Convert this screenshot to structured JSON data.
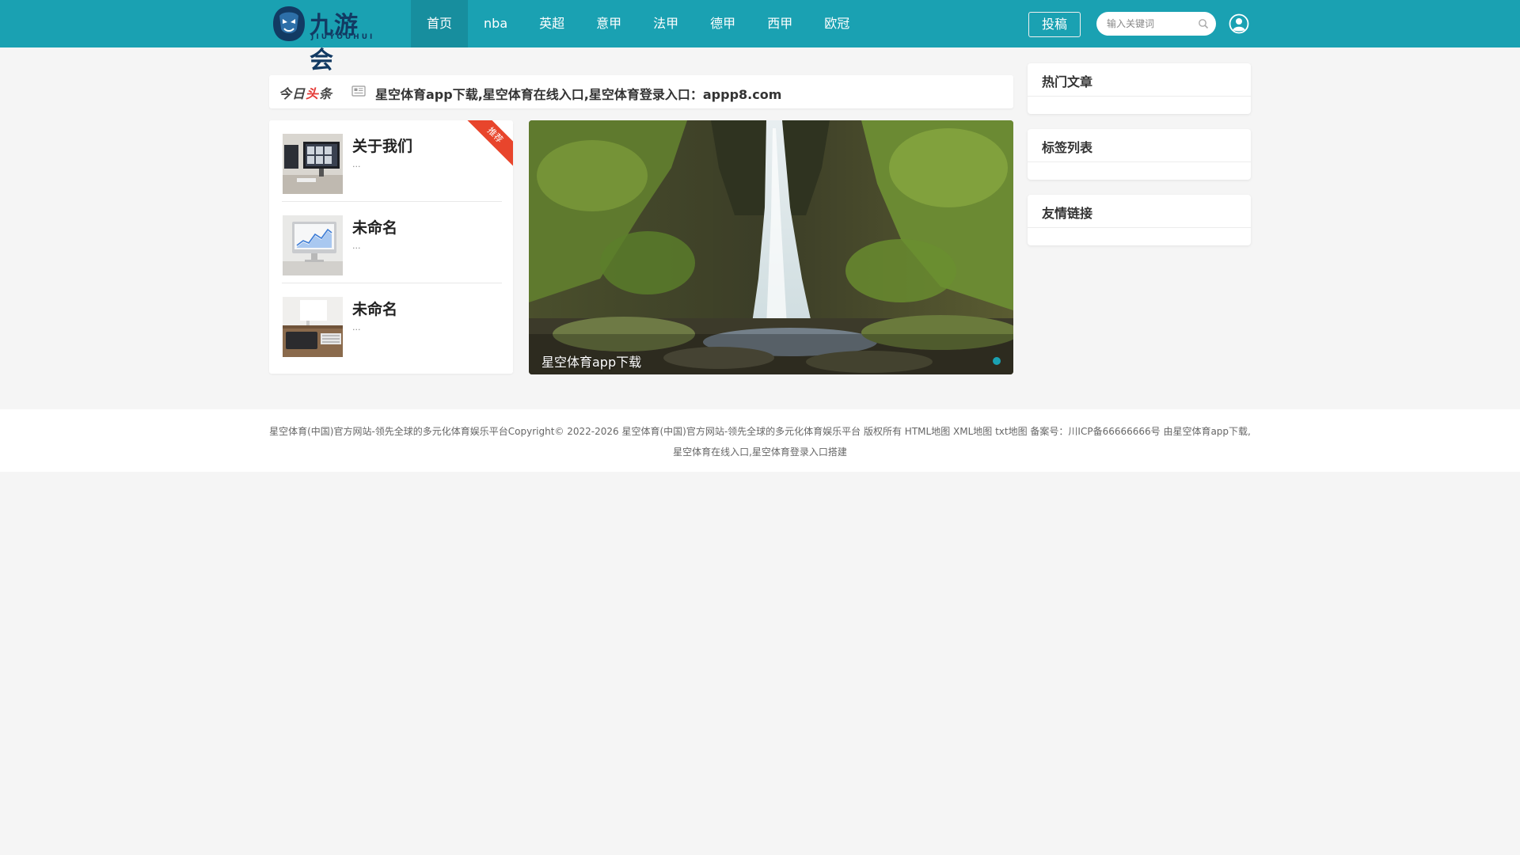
{
  "header": {
    "logo_text": "九游会",
    "logo_sub": "JIUYOUHUI",
    "nav": [
      {
        "label": "首页",
        "active": true
      },
      {
        "label": "nba"
      },
      {
        "label": "英超"
      },
      {
        "label": "意甲"
      },
      {
        "label": "法甲"
      },
      {
        "label": "德甲"
      },
      {
        "label": "西甲"
      },
      {
        "label": "欧冠"
      }
    ],
    "submit_label": "投稿",
    "search_placeholder": "输入关键词",
    "accent_color": "#1aa1b2"
  },
  "headline": {
    "badge_left": "今日",
    "badge_red": "头",
    "badge_right": "条",
    "text": "星空体育app下载,星空体育在线入口,星空体育登录入口：appp8.com"
  },
  "recommend": {
    "ribbon": "推荐",
    "items": [
      {
        "title": "关于我们",
        "desc": "..."
      },
      {
        "title": "未命名",
        "desc": "..."
      },
      {
        "title": "未命名",
        "desc": "..."
      }
    ]
  },
  "slider": {
    "caption": "星空体育app下载"
  },
  "sidebar": {
    "hot_title": "热门文章",
    "tags_title": "标签列表",
    "links_title": "友情链接"
  },
  "footer": {
    "line": "星空体育(中国)官方网站-领先全球的多元化体育娱乐平台Copyright© 2022-2026 星空体育(中国)官方网站-领先全球的多元化体育娱乐平台 版权所有 HTML地图 XML地图 txt地图 备案号：川ICP备66666666号 由星空体育app下载,星空体育在线入口,星空体育登录入口搭建"
  }
}
